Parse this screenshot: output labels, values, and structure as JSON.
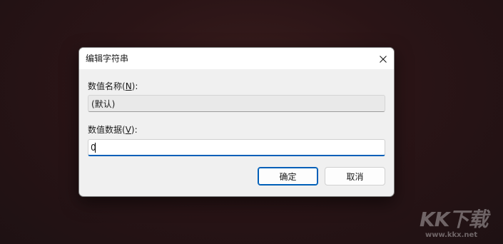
{
  "dialog": {
    "title": "编辑字符串",
    "close_icon": "close-icon"
  },
  "value_name": {
    "label_prefix": "数值名称(",
    "label_hotkey": "N",
    "label_suffix": "):",
    "value": "(默认)"
  },
  "value_data": {
    "label_prefix": "数值数据(",
    "label_hotkey": "V",
    "label_suffix": "):",
    "value": "0"
  },
  "buttons": {
    "ok_label": "确定",
    "cancel_label": "取消"
  },
  "watermark": {
    "logo": "KK下载",
    "url": "www.kkx.net"
  },
  "colors": {
    "accent": "#005fb8",
    "dialog_bg": "#f0f0f0",
    "titlebar_bg": "#ffffff"
  }
}
